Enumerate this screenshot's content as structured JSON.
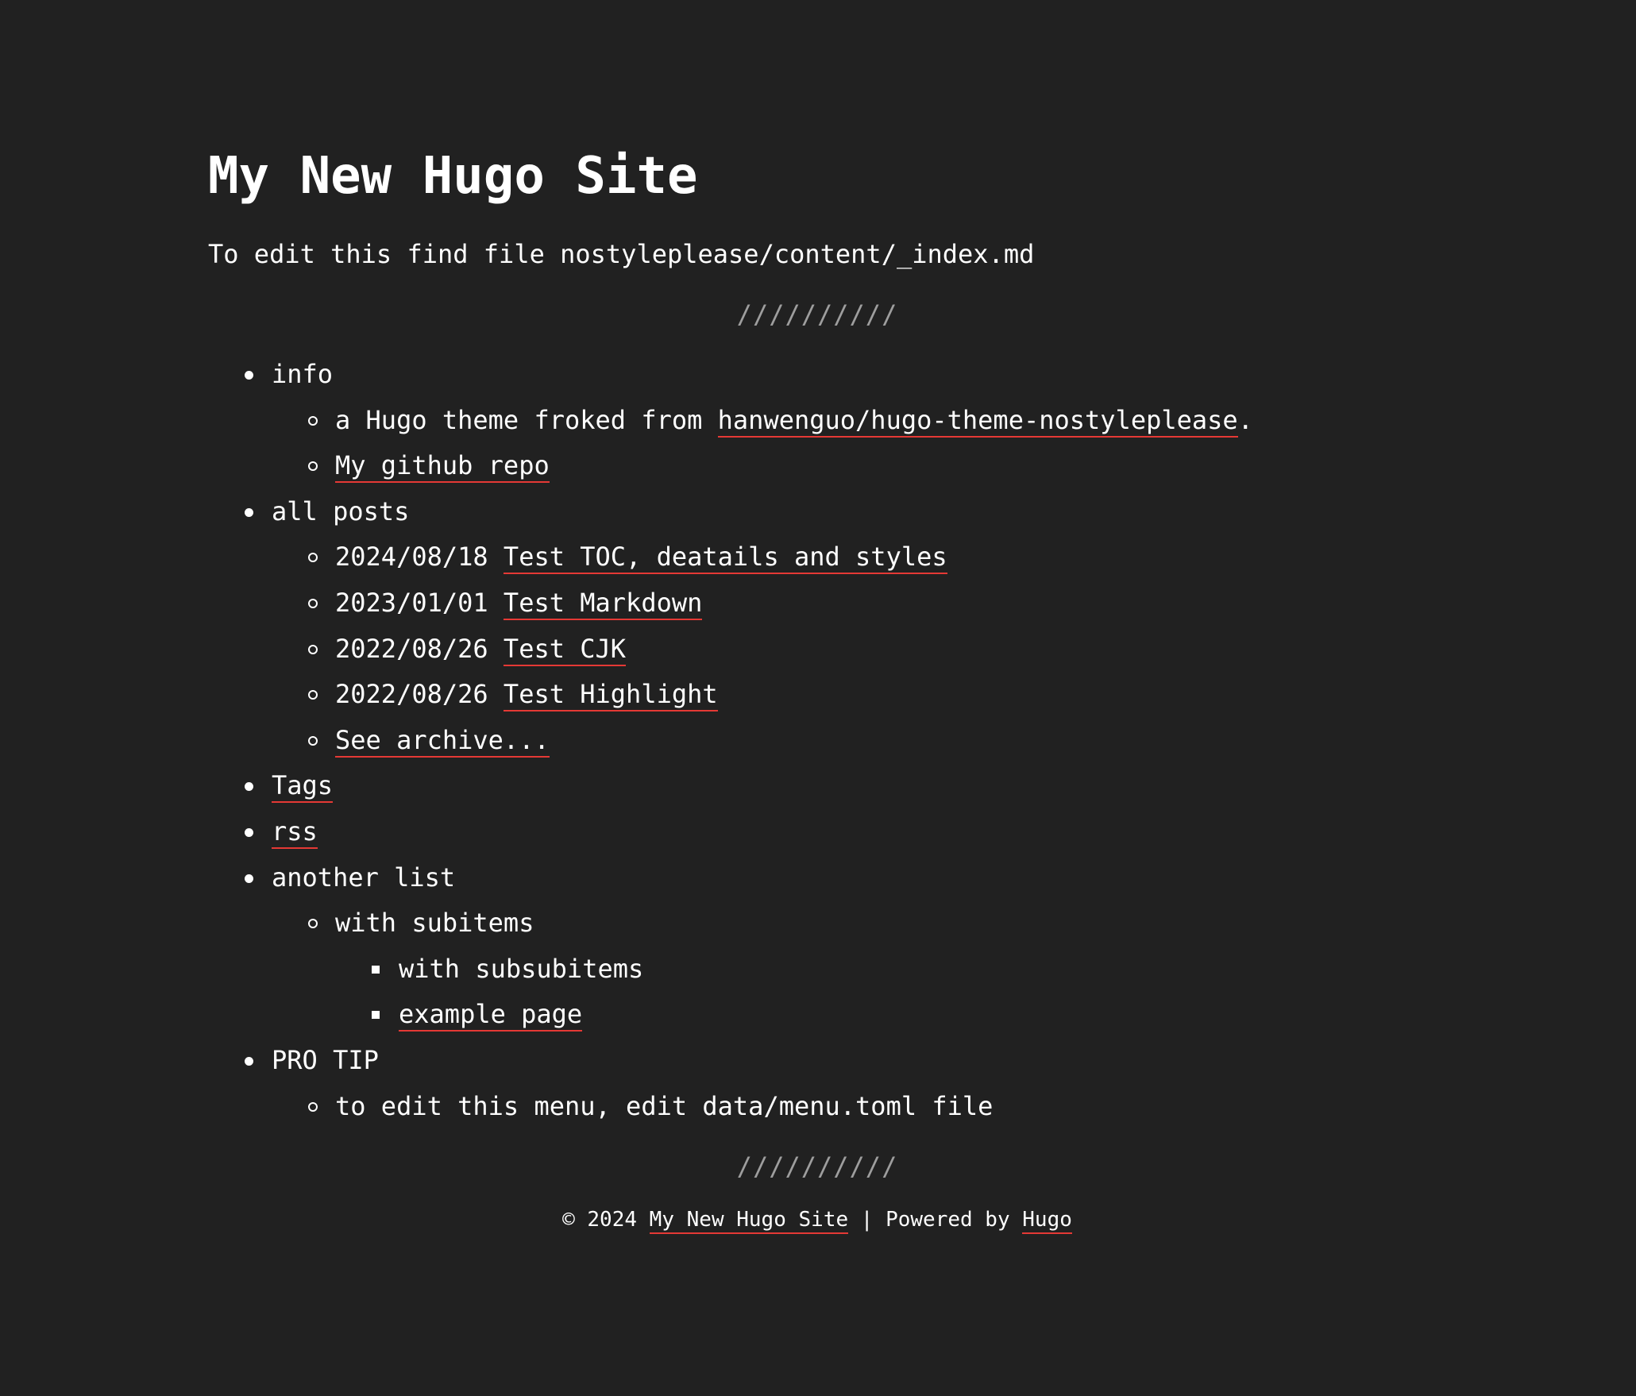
{
  "site": {
    "title": "My New Hugo Site",
    "intro": "To edit this find file nostyleplease/content/_index.md",
    "divider": "//////////"
  },
  "menu": {
    "info": {
      "label": "info",
      "theme_prefix": "a Hugo theme froked from ",
      "theme_link": "hanwenguo/hugo-theme-nostyleplease",
      "theme_suffix": ".",
      "repo_link": "My github repo"
    },
    "posts": {
      "label": "all posts",
      "items": [
        {
          "date": "2024/08/18",
          "title": "Test TOC, deatails and styles"
        },
        {
          "date": "2023/01/01",
          "title": "Test Markdown"
        },
        {
          "date": "2022/08/26",
          "title": "Test CJK"
        },
        {
          "date": "2022/08/26",
          "title": "Test Highlight"
        }
      ],
      "archive_link": "See archive..."
    },
    "tags_link": "Tags",
    "rss_link": "rss",
    "another": {
      "label": "another list",
      "subitem": "with subitems",
      "subsubitem": "with subsubitems",
      "example_link": "example page"
    },
    "protip": {
      "label": "PRO TIP",
      "text": "to edit this menu, edit data/menu.toml file"
    }
  },
  "footer": {
    "copyright": "© 2024 ",
    "site_link": "My New Hugo Site",
    "separator": " | Powered by ",
    "hugo_link": "Hugo"
  },
  "colors": {
    "background": "#212121",
    "text": "#ffffff",
    "link_underline": "#e53935",
    "divider": "#9e9e9e"
  }
}
